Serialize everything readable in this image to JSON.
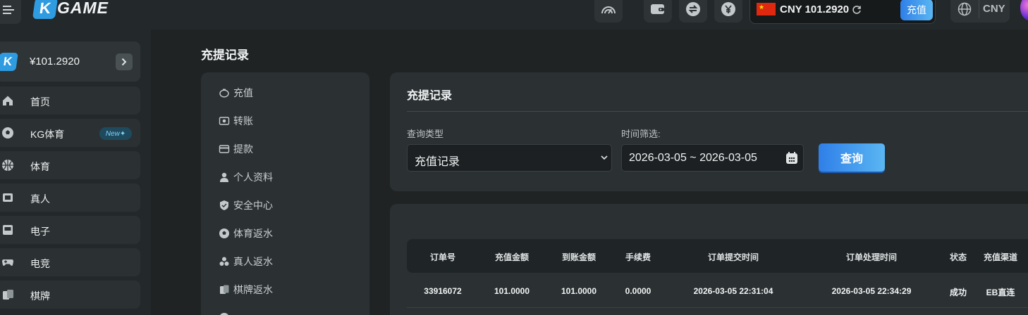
{
  "header": {
    "logo_mark": "K",
    "logo_text": "GAME",
    "balance_currency": "CNY",
    "balance_value": "101.2920",
    "deposit_label": "充值",
    "currency_select": "CNY"
  },
  "sidebar": {
    "wallet_logo": "K",
    "wallet_amount": "¥101.2920",
    "new_badge": "New",
    "items": [
      {
        "label": "首页",
        "icon": "home-icon"
      },
      {
        "label": "KG体育",
        "icon": "soccer-ball-icon"
      },
      {
        "label": "体育",
        "icon": "basketball-icon"
      },
      {
        "label": "真人",
        "icon": "live-casino-icon"
      },
      {
        "label": "电子",
        "icon": "slot-machine-icon"
      },
      {
        "label": "电竞",
        "icon": "gamepad-icon"
      },
      {
        "label": "棋牌",
        "icon": "cards-icon"
      }
    ]
  },
  "main": {
    "page_title": "充提记录",
    "submenu": [
      {
        "label": "充值",
        "icon": "piggy-bank-icon"
      },
      {
        "label": "转账",
        "icon": "transfer-icon"
      },
      {
        "label": "提款",
        "icon": "withdraw-icon"
      },
      {
        "label": "个人资料",
        "icon": "user-icon"
      },
      {
        "label": "安全中心",
        "icon": "shield-icon"
      },
      {
        "label": "体育返水",
        "icon": "soccer-icon"
      },
      {
        "label": "真人返水",
        "icon": "chips-icon"
      },
      {
        "label": "棋牌返水",
        "icon": "poker-icon"
      }
    ],
    "filter": {
      "title": "充提记录",
      "query_type_label": "查询类型",
      "query_type_value": "充值记录",
      "time_label": "时间筛选:",
      "date_range": "2026-03-05 ~ 2026-03-05",
      "query_button": "查询"
    },
    "table": {
      "columns": [
        "订单号",
        "充值金额",
        "到账金额",
        "手续费",
        "订单提交时间",
        "订单处理时间",
        "状态",
        "充值渠道"
      ],
      "rows": [
        [
          "33916072",
          "101.0000",
          "101.0000",
          "0.0000",
          "2026-03-05 22:31:04",
          "2026-03-05 22:34:29",
          "成功",
          "EB直连"
        ]
      ]
    }
  },
  "colors": {
    "accent_blue": "#2f7fe8",
    "accent_cyan": "#5ab6f2",
    "panel_bg": "#2b3133",
    "page_bg": "#1f2324"
  }
}
